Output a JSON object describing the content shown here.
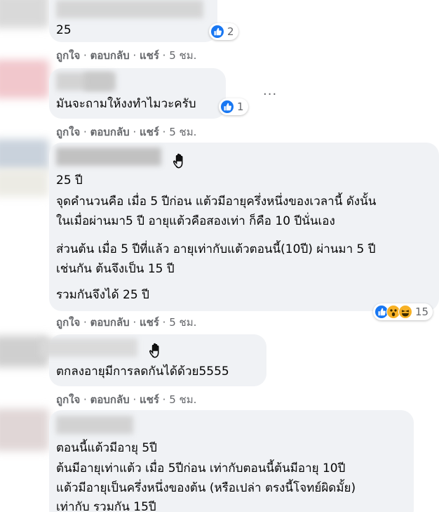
{
  "actions": {
    "like": "ถูกใจ",
    "reply": "ตอบกลับ",
    "share": "แชร์",
    "sep": " · "
  },
  "comments": [
    {
      "text": [
        "25"
      ],
      "time": "5 ชม.",
      "reactions": {
        "icons": [
          "like-icon"
        ],
        "count": "2"
      }
    },
    {
      "text": [
        "มันจะถามให้งงทำไมวะครับ"
      ],
      "time": "5 ชม.",
      "reactions": {
        "icons": [
          "like-icon"
        ],
        "count": "1"
      },
      "more": "···"
    },
    {
      "text": [
        "25 ปี",
        "จุดคำนวนคือ เมื่อ 5 ปีก่อน แต้วมีอายุครึ่งหนึ่งของเวลานี้ ดังนั้น",
        "ในเมื่อผ่านมา5 ปี อายุแต้วคือสองเท่า ก็คือ 10 ปีนั่นเอง",
        "ส่วนต้น เมื่อ 5 ปีที่แล้ว อายุเท่ากับแต้วตอนนี้(10ปี) ผ่านมา 5 ปี",
        "เช่นกัน ต้นจึงเป็น 15 ปี",
        "รวมกันจึงได้ 25 ปี"
      ],
      "time": "5 ชม.",
      "reactions": {
        "icons": [
          "like-icon",
          "wow-icon",
          "haha-icon"
        ],
        "count": "15"
      }
    },
    {
      "text": [
        "ตกลงอายุมีการลดกันได้ด้วย5555"
      ],
      "time": "5 ชม."
    },
    {
      "text": [
        "ตอนนี้แต้วมีอายุ 5ปี",
        "ต้นมีอายุเท่าแต้ว เมื่อ 5ปีก่อน เท่ากับตอนนี้ต้นมีอายุ 10ปี",
        "แต้วมีอายุเป็นครึ่งหนึ่งของต้น (หรือเปล่า ตรงนี้โจทย์ผิดมั้ย)",
        "เท่ากับ รวมกัน 15ปี"
      ]
    }
  ],
  "colors": {
    "bubble": "#f0f2f5",
    "meta": "#65676b",
    "like": "#1877f2",
    "wow": "#f7b125"
  }
}
